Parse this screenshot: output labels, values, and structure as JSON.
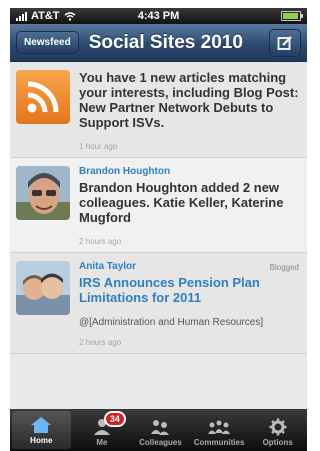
{
  "status_bar": {
    "carrier": "AT&T",
    "time": "4:43 PM"
  },
  "navbar": {
    "back_label": "Newsfeed",
    "title": "Social Sites 2010"
  },
  "feed": [
    {
      "icon": "rss-icon",
      "text": "You have 1 new articles matching your interests, including Blog Post: New Partner Network Debuts to Support ISVs.",
      "time": "1 hour ago"
    },
    {
      "author": "Brandon Houghton",
      "text": "Brandon Houghton added 2 new colleagues. Katie Keller, Katerine Mugford",
      "time": "2 hours ago"
    },
    {
      "author": "Anita Taylor",
      "tag": "Blogged",
      "text": "IRS Announces Pension Plan Limitations for 2011",
      "sub": "@[Administration and Human Resources]",
      "time": "2 hours ago"
    }
  ],
  "tabbar": {
    "tabs": [
      {
        "label": "Home",
        "icon": "home-icon",
        "active": true
      },
      {
        "label": "Me",
        "icon": "person-icon",
        "badge": "34"
      },
      {
        "label": "Colleagues",
        "icon": "colleagues-icon"
      },
      {
        "label": "Communities",
        "icon": "communities-icon"
      },
      {
        "label": "Options",
        "icon": "gear-icon"
      }
    ]
  },
  "colors": {
    "accent": "#2f7fc4",
    "navbar": "#2c4a70",
    "rss": "#f08a24"
  }
}
